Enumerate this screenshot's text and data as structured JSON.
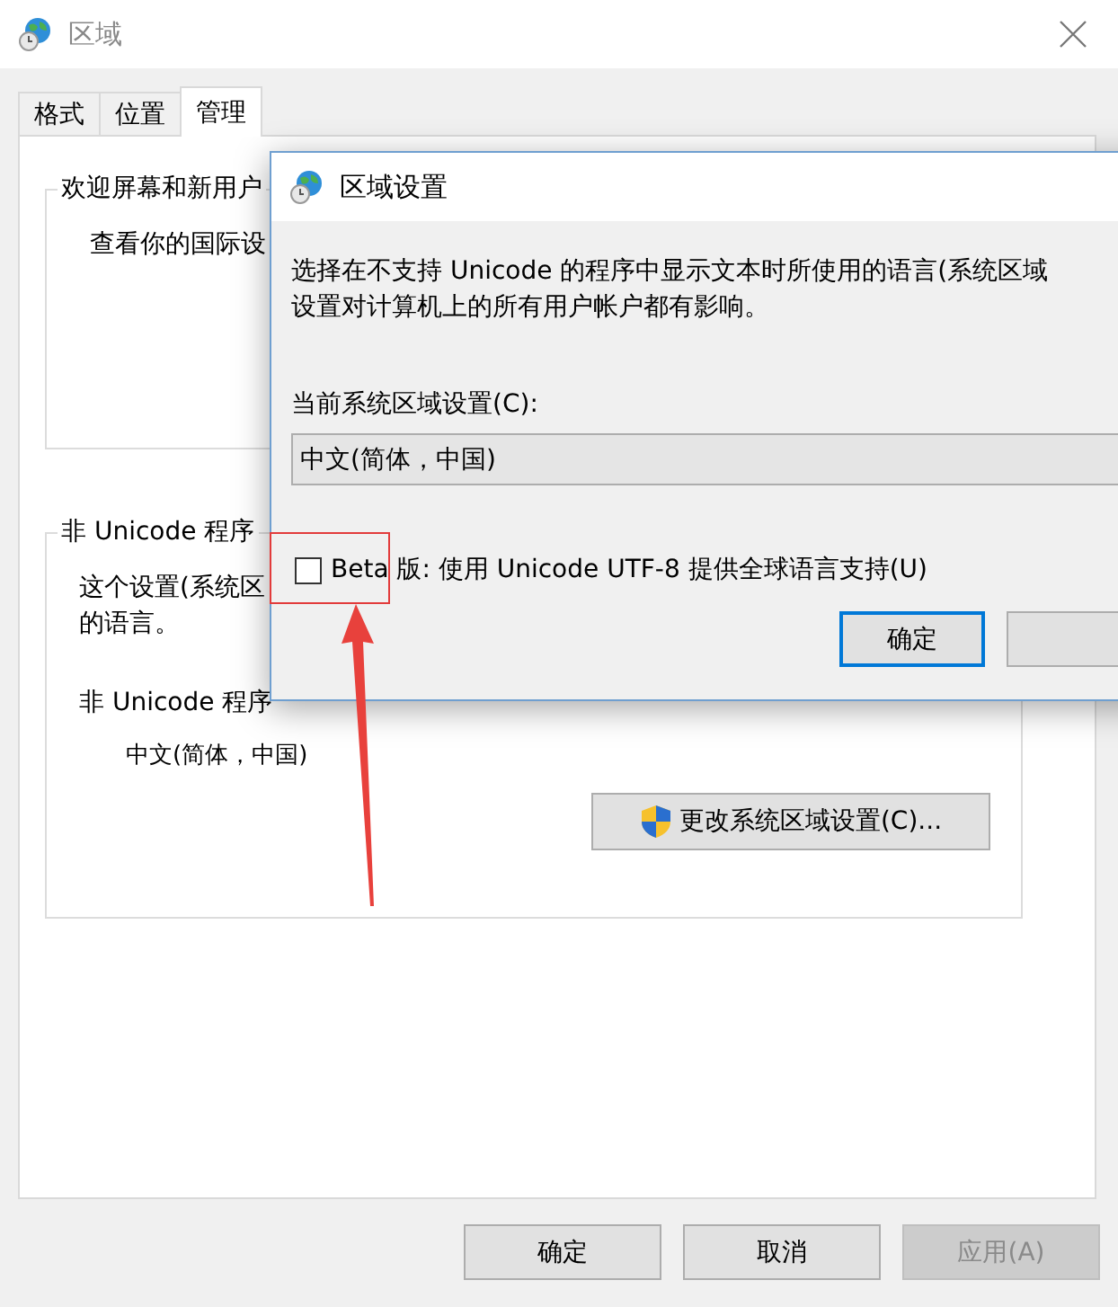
{
  "window": {
    "title": "区域"
  },
  "tabs": [
    {
      "label": "格式",
      "selected": false
    },
    {
      "label": "位置",
      "selected": false
    },
    {
      "label": "管理",
      "selected": true
    }
  ],
  "welcome_group": {
    "title": "欢迎屏幕和新用户",
    "text": "查看你的国际设"
  },
  "non_unicode_group": {
    "title": "非 Unicode 程序",
    "description": [
      "这个设置(系统区",
      "的语言。"
    ],
    "current_label": "非 Unicode 程序",
    "current_value": "中文(简体，中国)",
    "change_button": "更改系统区域设置(C)..."
  },
  "buttons": [
    {
      "label": "确定",
      "disabled": false
    },
    {
      "label": "取消",
      "disabled": false
    },
    {
      "label": "应用(A)",
      "disabled": true
    }
  ],
  "dialog": {
    "title": "区域设置",
    "description": [
      "选择在不支持 Unicode 的程序中显示文本时所使用的语言(系统区域",
      "设置对计算机上的所有用户帐户都有影响。"
    ],
    "locale_label": "当前系统区域设置(C):",
    "locale_value": "中文(简体，中国)",
    "beta_checkbox": {
      "label": "Beta 版: 使用 Unicode UTF-8 提供全球语言支持(U)",
      "checked": false
    },
    "buttons": [
      {
        "label": "确定",
        "default": true
      }
    ]
  }
}
